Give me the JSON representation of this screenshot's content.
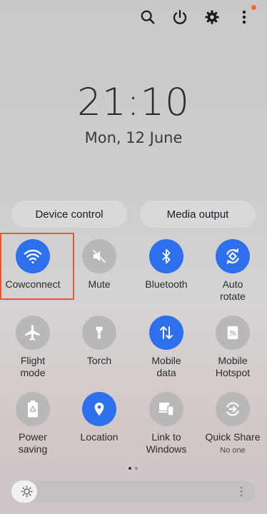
{
  "header": {
    "icons": [
      "search-icon",
      "power-icon",
      "gear-icon",
      "more-vert-icon"
    ],
    "notification_color": "#f26b2d"
  },
  "lockscreen": {
    "time": "21:10",
    "date": "Mon, 12 June"
  },
  "panel_buttons": {
    "device_control": "Device control",
    "media_output": "Media output"
  },
  "tiles": {
    "wifi": {
      "label": "Cowconnect",
      "on": true
    },
    "mute": {
      "label": "Mute",
      "on": false
    },
    "bluetooth": {
      "label": "Bluetooth",
      "on": true
    },
    "auto_rotate": {
      "label": "Auto\nrotate",
      "on": true
    },
    "flight_mode": {
      "label": "Flight\nmode",
      "on": false
    },
    "torch": {
      "label": "Torch",
      "on": false
    },
    "mobile_data": {
      "label": "Mobile\ndata",
      "on": true
    },
    "mobile_hotspot": {
      "label": "Mobile\nHotspot",
      "on": false
    },
    "power_saving": {
      "label": "Power\nsaving",
      "on": false
    },
    "location": {
      "label": "Location",
      "on": true
    },
    "link_to_windows": {
      "label": "Link to\nWindows",
      "on": false
    },
    "quick_share": {
      "label": "Quick Share",
      "sublabel": "No one",
      "on": false
    }
  },
  "pager": {
    "pages": 2,
    "current": 1
  },
  "brightness": {
    "level": 0.1
  },
  "colors": {
    "accent": "#2d6fec",
    "off": "#b9b7b9",
    "highlight": "#e8552e"
  }
}
